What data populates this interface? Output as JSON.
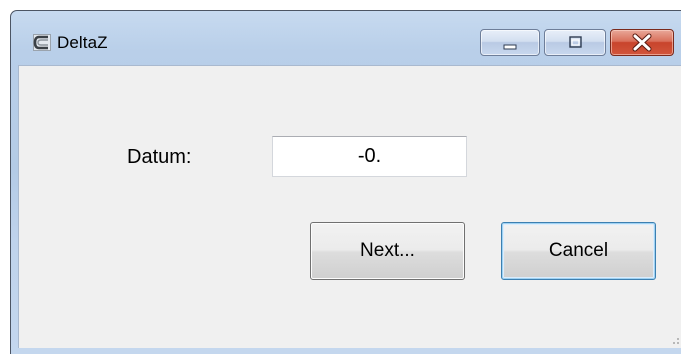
{
  "window": {
    "title": "DeltaZ",
    "app_icon": "deltaz-app-icon",
    "caption_buttons": [
      "minimize-icon",
      "maximize-icon",
      "close-icon"
    ],
    "colors": {
      "frame": "#b9cfe9",
      "client": "#f0f0f0",
      "close_button": "#c8442c"
    }
  },
  "form": {
    "datum_label": "Datum:",
    "datum_value": "-0.",
    "next_label": "Next...",
    "cancel_label": "Cancel"
  }
}
